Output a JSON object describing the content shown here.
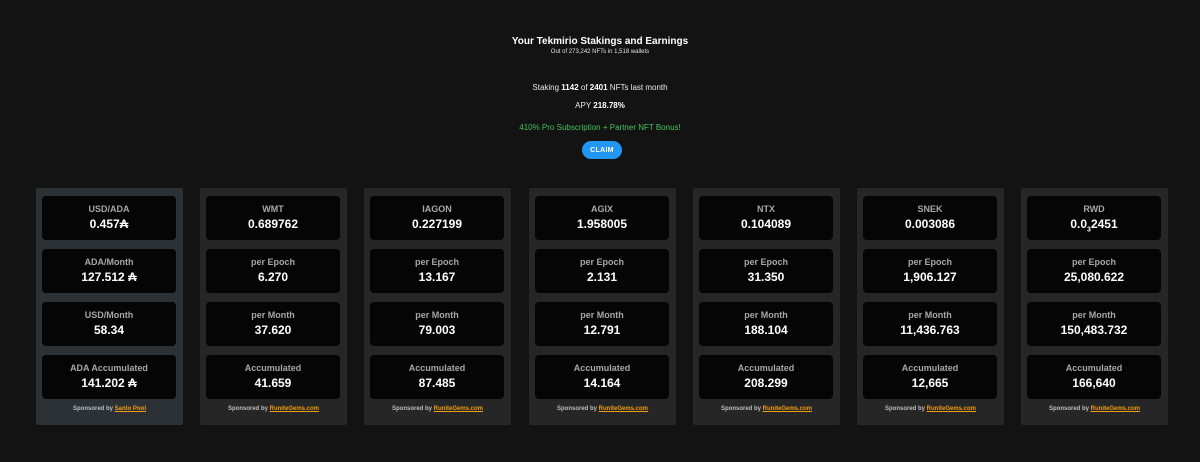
{
  "header": {
    "title": "Your Tekmirio Stakings and Earnings",
    "subtitle": "Out of 273,242 NFTs in 1,518 wallets",
    "staking_prefix": "Staking ",
    "staking_count": "1142",
    "staking_of": " of ",
    "staking_total": "2401",
    "staking_suffix": " NFTs last month",
    "apy_label": "APY ",
    "apy_value": "218.78%",
    "bonus": "410% Pro Subscription + Partner NFT Bonus!",
    "claim_label": "CLAIM"
  },
  "colors": {
    "background": "#131313",
    "card": "#262626",
    "card_ada": "#2b3135",
    "cell": "#050505",
    "bonus_green": "#44c25a",
    "claim_blue": "#2196f3",
    "link_orange": "#f29d12"
  },
  "cards": [
    {
      "cells": [
        {
          "label": "USD/ADA",
          "value": "0.457₳"
        },
        {
          "label": "ADA/Month",
          "value": "127.512 ₳"
        },
        {
          "label": "USD/Month",
          "value": "58.34"
        },
        {
          "label": "ADA Accumulated",
          "value": "141.202 ₳"
        }
      ],
      "sponsor_prefix": "Sponsored by ",
      "sponsor_link": "Santo Pool"
    },
    {
      "cells": [
        {
          "label": "WMT",
          "value": "0.689762"
        },
        {
          "label": "per Epoch",
          "value": "6.270"
        },
        {
          "label": "per Month",
          "value": "37.620"
        },
        {
          "label": "Accumulated",
          "value": "41.659"
        }
      ],
      "sponsor_prefix": "Sponsored by ",
      "sponsor_link": "RuniteGems.com"
    },
    {
      "cells": [
        {
          "label": "IAGON",
          "value": "0.227199"
        },
        {
          "label": "per Epoch",
          "value": "13.167"
        },
        {
          "label": "per Month",
          "value": "79.003"
        },
        {
          "label": "Accumulated",
          "value": "87.485"
        }
      ],
      "sponsor_prefix": "Sponsored by ",
      "sponsor_link": "RuniteGems.com"
    },
    {
      "cells": [
        {
          "label": "AGIX",
          "value": "1.958005"
        },
        {
          "label": "per Epoch",
          "value": "2.131"
        },
        {
          "label": "per Month",
          "value": "12.791"
        },
        {
          "label": "Accumulated",
          "value": "14.164"
        }
      ],
      "sponsor_prefix": "Sponsored by ",
      "sponsor_link": "RuniteGems.com"
    },
    {
      "cells": [
        {
          "label": "NTX",
          "value": "0.104089"
        },
        {
          "label": "per Epoch",
          "value": "31.350"
        },
        {
          "label": "per Month",
          "value": "188.104"
        },
        {
          "label": "Accumulated",
          "value": "208.299"
        }
      ],
      "sponsor_prefix": "Sponsored by ",
      "sponsor_link": "RuniteGems.com"
    },
    {
      "cells": [
        {
          "label": "SNEK",
          "value": "0.003086"
        },
        {
          "label": "per Epoch",
          "value": "1,906.127"
        },
        {
          "label": "per Month",
          "value": "11,436.763"
        },
        {
          "label": "Accumulated",
          "value": "12,665"
        }
      ],
      "sponsor_prefix": "Sponsored by ",
      "sponsor_link": "RuniteGems.com"
    },
    {
      "cells": [
        {
          "label": "RWD",
          "value_main": "0.0",
          "value_sub": "3",
          "value_rest": "2451"
        },
        {
          "label": "per Epoch",
          "value": "25,080.622"
        },
        {
          "label": "per Month",
          "value": "150,483.732"
        },
        {
          "label": "Accumulated",
          "value": "166,640"
        }
      ],
      "sponsor_prefix": "Sponsored by ",
      "sponsor_link": "RuniteGems.com"
    }
  ]
}
